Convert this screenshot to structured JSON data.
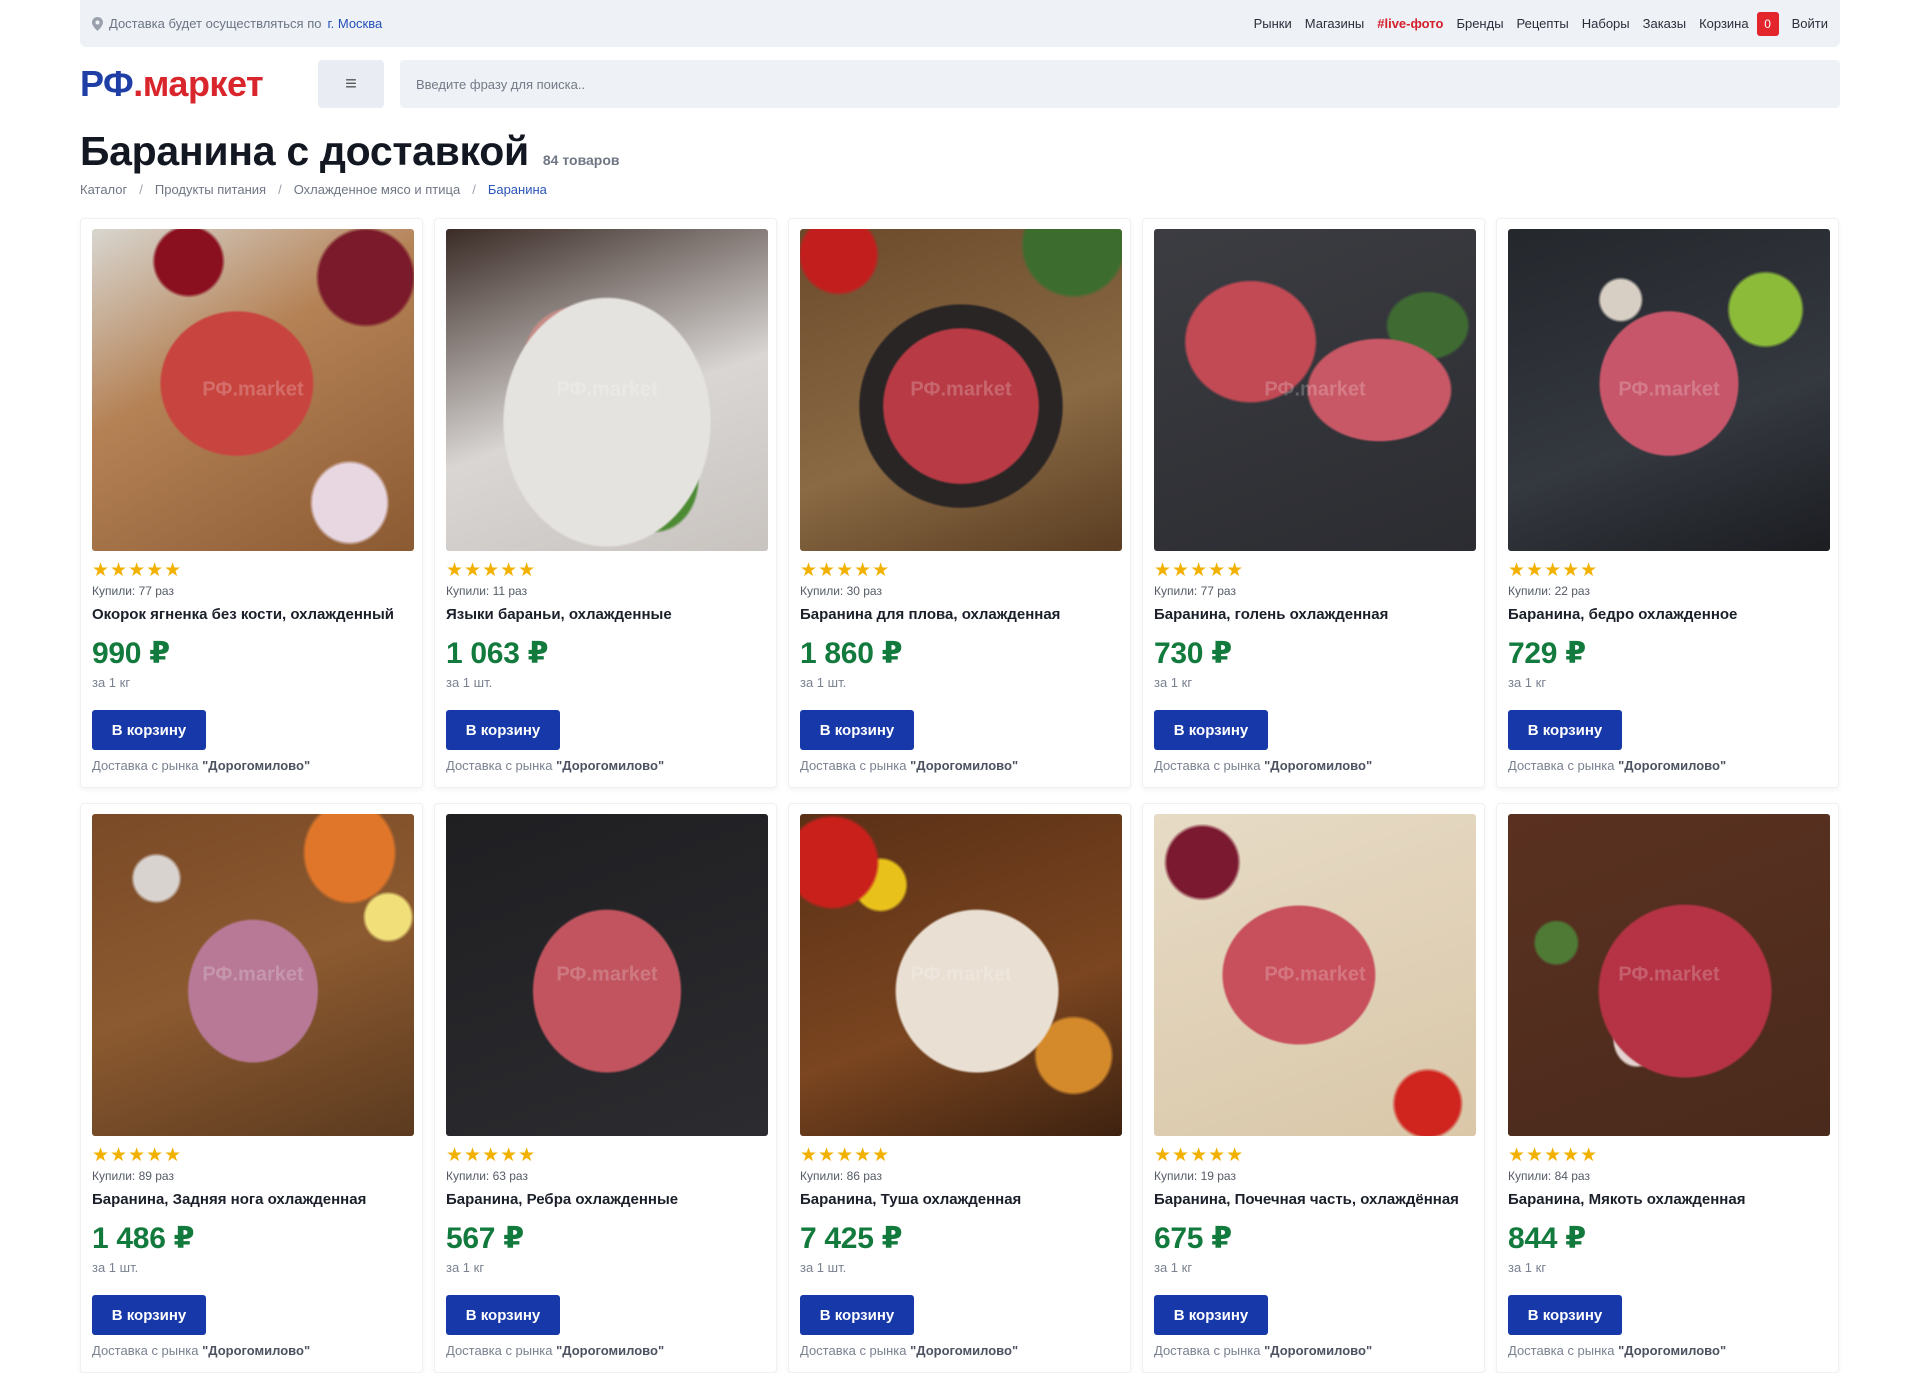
{
  "topbar": {
    "delivery_text": "Доставка будет осуществляться по",
    "city": "г. Москва",
    "nav": [
      "Рынки",
      "Магазины",
      "#live-фото",
      "Бренды",
      "Рецепты",
      "Наборы",
      "Заказы"
    ],
    "cart_label": "Корзина",
    "cart_count": "0",
    "login_label": "Войти"
  },
  "header": {
    "logo_rf": "РФ",
    "logo_market": ".маркет",
    "menu_icon": "≡",
    "search_placeholder": "Введите фразу для поиска.."
  },
  "page": {
    "title": "Баранина с доставкой",
    "count": "84 товаров"
  },
  "breadcrumb": [
    "Каталог",
    "Продукты питания",
    "Охлажденное мясо и птица",
    "Баранина"
  ],
  "watermark": "РФ.market",
  "products": [
    {
      "stars": "★★★★★",
      "bought": "Купили: 77 раз",
      "name": "Окорок ягненка без кости, охлажденный",
      "price": "990 ₽",
      "unit": "за 1 кг",
      "button": "В корзину",
      "delivery_prefix": "Доставка с рынка ",
      "market": "\"Дорогомилово\""
    },
    {
      "stars": "★★★★★",
      "bought": "Купили: 11 раз",
      "name": "Языки бараньи, охлажденные",
      "price": "1 063 ₽",
      "unit": "за 1 шт.",
      "button": "В корзину",
      "delivery_prefix": "Доставка с рынка ",
      "market": "\"Дорогомилово\""
    },
    {
      "stars": "★★★★★",
      "bought": "Купили: 30 раз",
      "name": "Баранина для плова, охлажденная",
      "price": "1 860 ₽",
      "unit": "за 1 шт.",
      "button": "В корзину",
      "delivery_prefix": "Доставка с рынка ",
      "market": "\"Дорогомилово\""
    },
    {
      "stars": "★★★★★",
      "bought": "Купили: 77 раз",
      "name": "Баранина, голень охлажденная",
      "price": "730 ₽",
      "unit": "за 1 кг",
      "button": "В корзину",
      "delivery_prefix": "Доставка с рынка ",
      "market": "\"Дорогомилово\""
    },
    {
      "stars": "★★★★★",
      "bought": "Купили: 22 раз",
      "name": "Баранина, бедро охлажденное",
      "price": "729 ₽",
      "unit": "за 1 кг",
      "button": "В корзину",
      "delivery_prefix": "Доставка с рынка ",
      "market": "\"Дорогомилово\""
    },
    {
      "stars": "★★★★★",
      "bought": "Купили: 89 раз",
      "name": "Баранина, Задняя нога охлажденная",
      "price": "1 486 ₽",
      "unit": "за 1 шт.",
      "button": "В корзину",
      "delivery_prefix": "Доставка с рынка ",
      "market": "\"Дорогомилово\""
    },
    {
      "stars": "★★★★★",
      "bought": "Купили: 63 раз",
      "name": "Баранина, Ребра охлажденные",
      "price": "567 ₽",
      "unit": "за 1 кг",
      "button": "В корзину",
      "delivery_prefix": "Доставка с рынка ",
      "market": "\"Дорогомилово\""
    },
    {
      "stars": "★★★★★",
      "bought": "Купили: 86 раз",
      "name": "Баранина, Туша охлажденная",
      "price": "7 425 ₽",
      "unit": "за 1 шт.",
      "button": "В корзину",
      "delivery_prefix": "Доставка с рынка ",
      "market": "\"Дорогомилово\""
    },
    {
      "stars": "★★★★★",
      "bought": "Купили: 19 раз",
      "name": "Баранина, Почечная часть, охлаждённая",
      "price": "675 ₽",
      "unit": "за 1 кг",
      "button": "В корзину",
      "delivery_prefix": "Доставка с рынка ",
      "market": "\"Дорогомилово\""
    },
    {
      "stars": "★★★★★",
      "bought": "Купили: 84 раз",
      "name": "Баранина, Мякоть охлажденная",
      "price": "844 ₽",
      "unit": "за 1 кг",
      "button": "В корзину",
      "delivery_prefix": "Доставка с рынка ",
      "market": "\"Дорогомилово\""
    }
  ],
  "colors": {
    "brand_blue": "#1f3fa6",
    "brand_red": "#d9262d",
    "price_green": "#137a3d",
    "button_blue": "#1738a8",
    "star_gold": "#f2b100"
  }
}
